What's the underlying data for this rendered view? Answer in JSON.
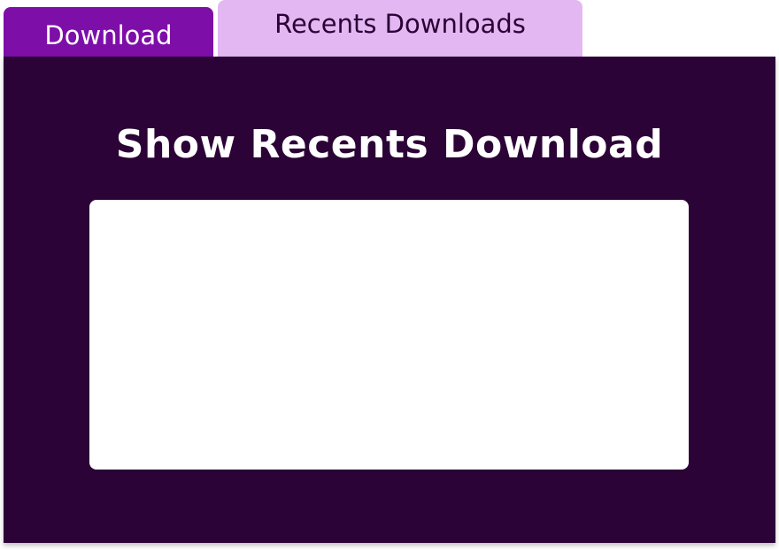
{
  "tabs": {
    "download": {
      "label": "Download"
    },
    "recents": {
      "label": "Recents Downloads"
    }
  },
  "panel": {
    "title": "Show Recents Download"
  },
  "colors": {
    "download_tab_bg": "#7e0ea8",
    "recents_tab_bg": "#e3b8f2",
    "panel_bg": "#2c0337",
    "list_bg": "#ffffff"
  }
}
